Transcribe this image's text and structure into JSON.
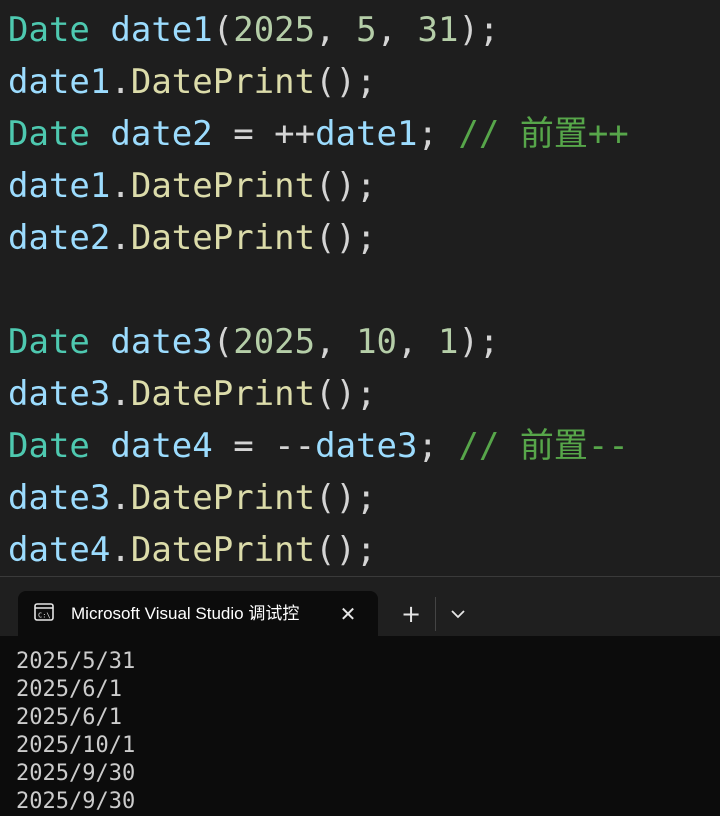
{
  "editor": {
    "lines": [
      {
        "tokens": [
          {
            "t": "Date",
            "c": "type"
          },
          {
            "t": " ",
            "c": "punct"
          },
          {
            "t": "date1",
            "c": "var"
          },
          {
            "t": "(",
            "c": "punct"
          },
          {
            "t": "2025",
            "c": "num"
          },
          {
            "t": ", ",
            "c": "punct"
          },
          {
            "t": "5",
            "c": "num"
          },
          {
            "t": ", ",
            "c": "punct"
          },
          {
            "t": "31",
            "c": "num"
          },
          {
            "t": ");",
            "c": "punct"
          }
        ]
      },
      {
        "tokens": [
          {
            "t": "date1",
            "c": "var"
          },
          {
            "t": ".",
            "c": "punct"
          },
          {
            "t": "DatePrint",
            "c": "fn"
          },
          {
            "t": "();",
            "c": "punct"
          }
        ]
      },
      {
        "tokens": [
          {
            "t": "Date",
            "c": "type"
          },
          {
            "t": " ",
            "c": "punct"
          },
          {
            "t": "date2",
            "c": "var"
          },
          {
            "t": " = ++",
            "c": "punct"
          },
          {
            "t": "date1",
            "c": "var"
          },
          {
            "t": "; ",
            "c": "punct"
          },
          {
            "t": "// 前置++",
            "c": "comment"
          }
        ]
      },
      {
        "tokens": [
          {
            "t": "date1",
            "c": "var"
          },
          {
            "t": ".",
            "c": "punct"
          },
          {
            "t": "DatePrint",
            "c": "fn"
          },
          {
            "t": "();",
            "c": "punct"
          }
        ]
      },
      {
        "tokens": [
          {
            "t": "date2",
            "c": "var"
          },
          {
            "t": ".",
            "c": "punct"
          },
          {
            "t": "DatePrint",
            "c": "fn"
          },
          {
            "t": "();",
            "c": "punct"
          }
        ]
      },
      {
        "tokens": []
      },
      {
        "tokens": [
          {
            "t": "Date",
            "c": "type"
          },
          {
            "t": " ",
            "c": "punct"
          },
          {
            "t": "date3",
            "c": "var"
          },
          {
            "t": "(",
            "c": "punct"
          },
          {
            "t": "2025",
            "c": "num"
          },
          {
            "t": ", ",
            "c": "punct"
          },
          {
            "t": "10",
            "c": "num"
          },
          {
            "t": ", ",
            "c": "punct"
          },
          {
            "t": "1",
            "c": "num"
          },
          {
            "t": ");",
            "c": "punct"
          }
        ]
      },
      {
        "tokens": [
          {
            "t": "date3",
            "c": "var"
          },
          {
            "t": ".",
            "c": "punct"
          },
          {
            "t": "DatePrint",
            "c": "fn"
          },
          {
            "t": "();",
            "c": "punct"
          }
        ]
      },
      {
        "tokens": [
          {
            "t": "Date",
            "c": "type"
          },
          {
            "t": " ",
            "c": "punct"
          },
          {
            "t": "date4",
            "c": "var"
          },
          {
            "t": " = --",
            "c": "punct"
          },
          {
            "t": "date3",
            "c": "var"
          },
          {
            "t": "; ",
            "c": "punct"
          },
          {
            "t": "// 前置--",
            "c": "comment"
          }
        ]
      },
      {
        "tokens": [
          {
            "t": "date3",
            "c": "var"
          },
          {
            "t": ".",
            "c": "punct"
          },
          {
            "t": "DatePrint",
            "c": "fn"
          },
          {
            "t": "();",
            "c": "punct"
          }
        ]
      },
      {
        "tokens": [
          {
            "t": "date4",
            "c": "var"
          },
          {
            "t": ".",
            "c": "punct"
          },
          {
            "t": "DatePrint",
            "c": "fn"
          },
          {
            "t": "();",
            "c": "punct"
          }
        ]
      }
    ]
  },
  "terminal": {
    "tab": {
      "icon": "console-app-icon",
      "title": "Microsoft Visual Studio 调试控",
      "close_icon": "close-icon"
    },
    "new_tab_icon": "plus-icon",
    "dropdown_icon": "chevron-down-icon",
    "output": [
      "2025/5/31",
      "2025/6/1",
      "2025/6/1",
      "2025/10/1",
      "2025/9/30",
      "2025/9/30"
    ]
  },
  "colors": {
    "editor_bg": "#1e1e1e",
    "type": "#4ec9b0",
    "variable": "#9cdcfe",
    "function": "#dcdcaa",
    "number": "#b5cea8",
    "comment": "#57a64a",
    "terminal_bg": "#0c0c0c"
  }
}
